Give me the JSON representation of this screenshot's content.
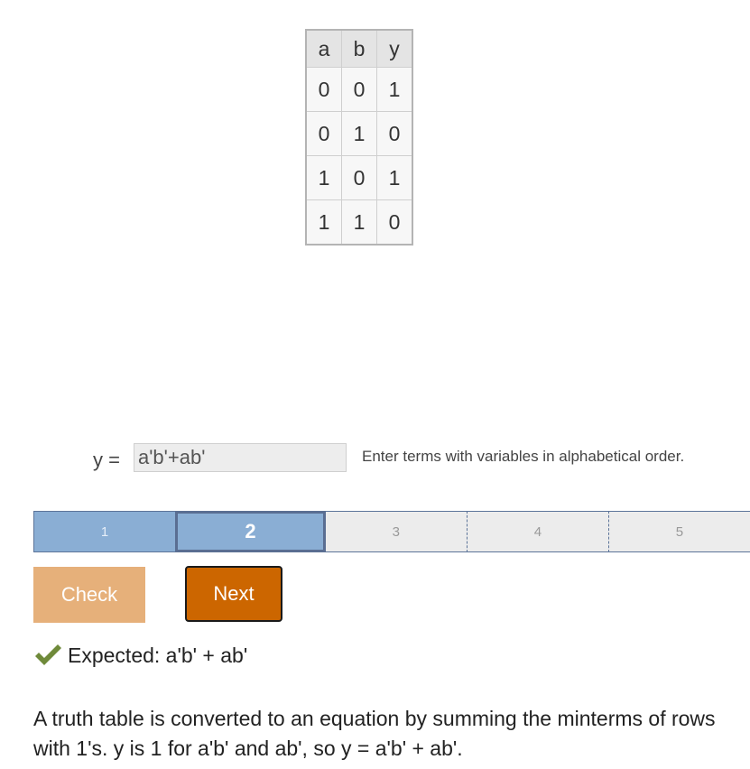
{
  "truth_table": {
    "headers": [
      "a",
      "b",
      "y"
    ],
    "rows": [
      [
        "0",
        "0",
        "1"
      ],
      [
        "0",
        "1",
        "0"
      ],
      [
        "1",
        "0",
        "1"
      ],
      [
        "1",
        "1",
        "0"
      ]
    ]
  },
  "equation": {
    "label": "y =",
    "value": "a'b'+ab'",
    "hint": "Enter terms with variables in alphabetical order."
  },
  "progress": {
    "steps": [
      "1",
      "2",
      "3",
      "4",
      "5"
    ],
    "current": 2
  },
  "buttons": {
    "check": "Check",
    "next": "Next"
  },
  "feedback": {
    "icon": "checkmark-icon",
    "text": "Expected: a'b' + ab'"
  },
  "explanation": "A truth table is converted to an equation by summing the minterms of rows with 1's. y is 1 for a'b' and ab', so y = a'b' + ab'.",
  "colors": {
    "step_done": "#8aaed4",
    "next_button": "#cc6600",
    "check_button": "#e6b07a",
    "checkmark": "#6f8a3a"
  }
}
